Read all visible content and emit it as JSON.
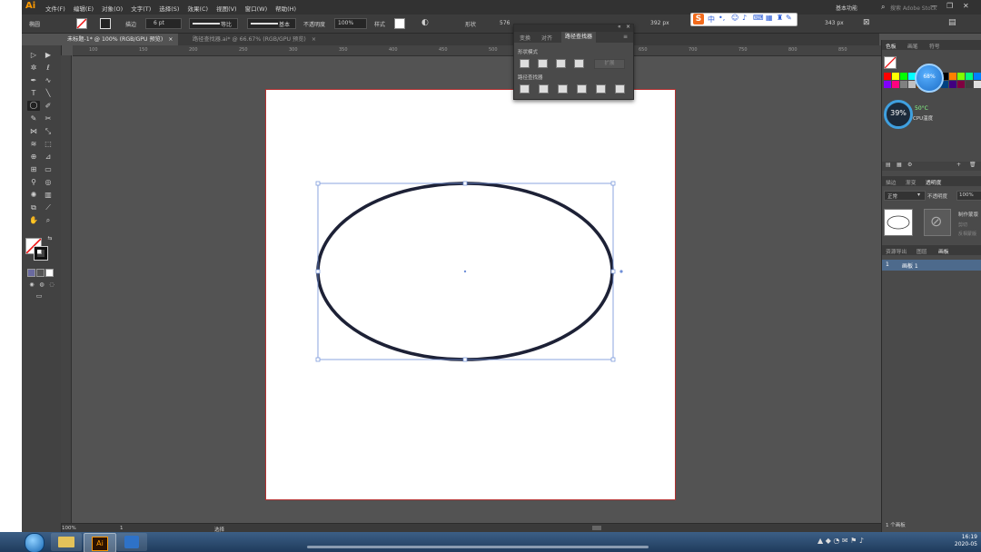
{
  "app": {
    "logo": "Ai"
  },
  "menu": [
    "文件(F)",
    "编辑(E)",
    "对象(O)",
    "文字(T)",
    "选择(S)",
    "效果(C)",
    "视图(V)",
    "窗口(W)",
    "帮助(H)"
  ],
  "workspace": {
    "label": "基本功能",
    "search_placeholder": "搜索 Adobe Stock"
  },
  "control": {
    "object_label": "椭圆",
    "stroke_label": "描边",
    "stroke_weight": "6 pt",
    "stroke_profile": "等比",
    "brush": "基本",
    "opacity_label": "不透明度",
    "opacity_value": "100%",
    "style_label": "样式",
    "shape_label": "形状",
    "x_value": "576",
    "w_value": "392 px",
    "h_value": "343 px"
  },
  "tabs": [
    {
      "label": "未标题-1* @ 100% (RGB/GPU 预览)",
      "active": true
    },
    {
      "label": "路径查找器.ai* @ 66.67% (RGB/GPU 预览)",
      "active": false
    }
  ],
  "ruler_top": [
    "100",
    "150",
    "200",
    "250",
    "300",
    "350",
    "400",
    "450",
    "500",
    "550",
    "600",
    "650",
    "700",
    "750",
    "800",
    "850"
  ],
  "pathfinder_panel": {
    "tabs": [
      "变换",
      "对齐",
      "路径查找器"
    ],
    "shape_modes_label": "形状模式",
    "expand_label": "扩展",
    "pathfinders_label": "路径查找器"
  },
  "ime": {
    "brand": "S",
    "lang": "中"
  },
  "right_panel": {
    "top_tabs": [
      "色板",
      "画笔",
      "符号"
    ],
    "hud_memory": "68%",
    "cpu_temp": "50°C",
    "cpu_label": "CPU温度",
    "cpu_percent": "39%",
    "mid_tabs": [
      "描边",
      "渐变",
      "透明度"
    ],
    "blend_mode": "正常",
    "opacity_label": "不透明度",
    "opacity_value": "100%",
    "make_mask": "制作蒙版",
    "clip_label": "剪切",
    "invert_label": "反相蒙版",
    "bottom_tabs": [
      "资源导出",
      "图层",
      "画板"
    ],
    "artboard_row": {
      "index": "1",
      "name": "画板 1"
    },
    "footer": "1 个画板"
  },
  "status": {
    "zoom": "100%",
    "page": "1",
    "tool": "选择"
  },
  "clock": {
    "time": "16:19",
    "date": "2020-05"
  },
  "colors": {
    "ellipse_stroke": "#1d2136",
    "selection": "#4a76d8",
    "artboard_border": "#b23030",
    "accent_orange": "#ff9a00"
  },
  "swatches": [
    "#ff0000",
    "#ffff00",
    "#00ff00",
    "#00ffff",
    "#0000ff",
    "#ff00ff",
    "#ffffff",
    "#000000",
    "#ff8000",
    "#80ff00",
    "#00ff80",
    "#0080ff",
    "#8000ff",
    "#ff0080",
    "#808080",
    "#c0c0c0",
    "#804000",
    "#408000",
    "#008040",
    "#004080",
    "#400080",
    "#800040",
    "#404040",
    "#e0e0e0"
  ]
}
